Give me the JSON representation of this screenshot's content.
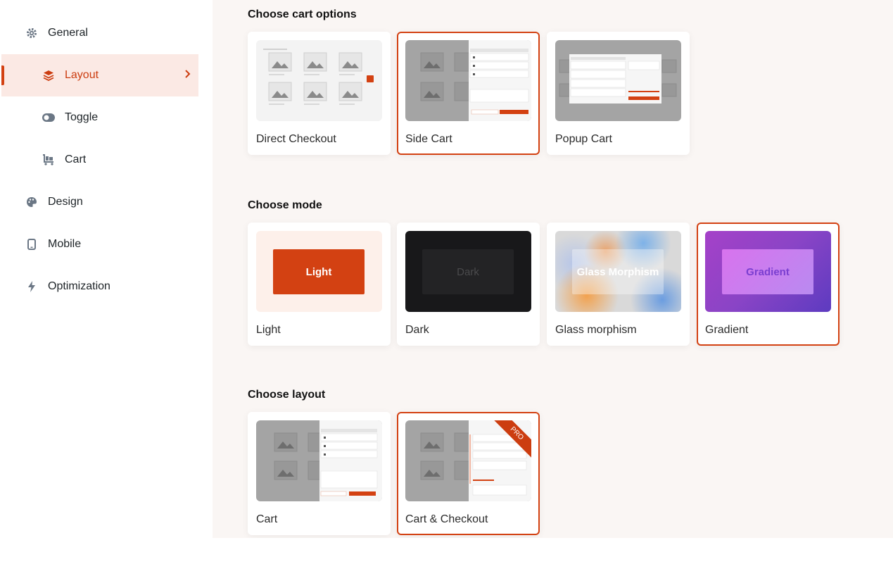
{
  "sidebar": {
    "items": [
      {
        "label": "General",
        "icon": "gear-icon"
      },
      {
        "label": "Layout",
        "icon": "layers-icon",
        "active": true
      },
      {
        "label": "Toggle",
        "icon": "toggle-icon"
      },
      {
        "label": "Cart",
        "icon": "cart-icon"
      },
      {
        "label": "Design",
        "icon": "palette-icon"
      },
      {
        "label": "Mobile",
        "icon": "mobile-icon"
      },
      {
        "label": "Optimization",
        "icon": "bolt-icon"
      }
    ]
  },
  "sections": {
    "cart_options": {
      "title": "Choose cart options",
      "cards": [
        {
          "label": "Direct Checkout",
          "selected": false
        },
        {
          "label": "Side Cart",
          "selected": true
        },
        {
          "label": "Popup Cart",
          "selected": false
        }
      ]
    },
    "mode": {
      "title": "Choose mode",
      "cards": [
        {
          "label": "Light",
          "preview_text": "Light",
          "selected": false
        },
        {
          "label": "Dark",
          "preview_text": "Dark",
          "selected": false
        },
        {
          "label": "Glass morphism",
          "preview_text": "Glass Morphism",
          "selected": false
        },
        {
          "label": "Gradient",
          "preview_text": "Gradient",
          "selected": true
        }
      ]
    },
    "layout": {
      "title": "Choose layout",
      "cards": [
        {
          "label": "Cart",
          "selected": false
        },
        {
          "label": "Cart & Checkout",
          "selected": true,
          "badge": "PRO"
        }
      ]
    }
  },
  "colors": {
    "accent": "#d34112",
    "active_bg": "#fbe9e4",
    "main_bg": "#faf6f4"
  }
}
